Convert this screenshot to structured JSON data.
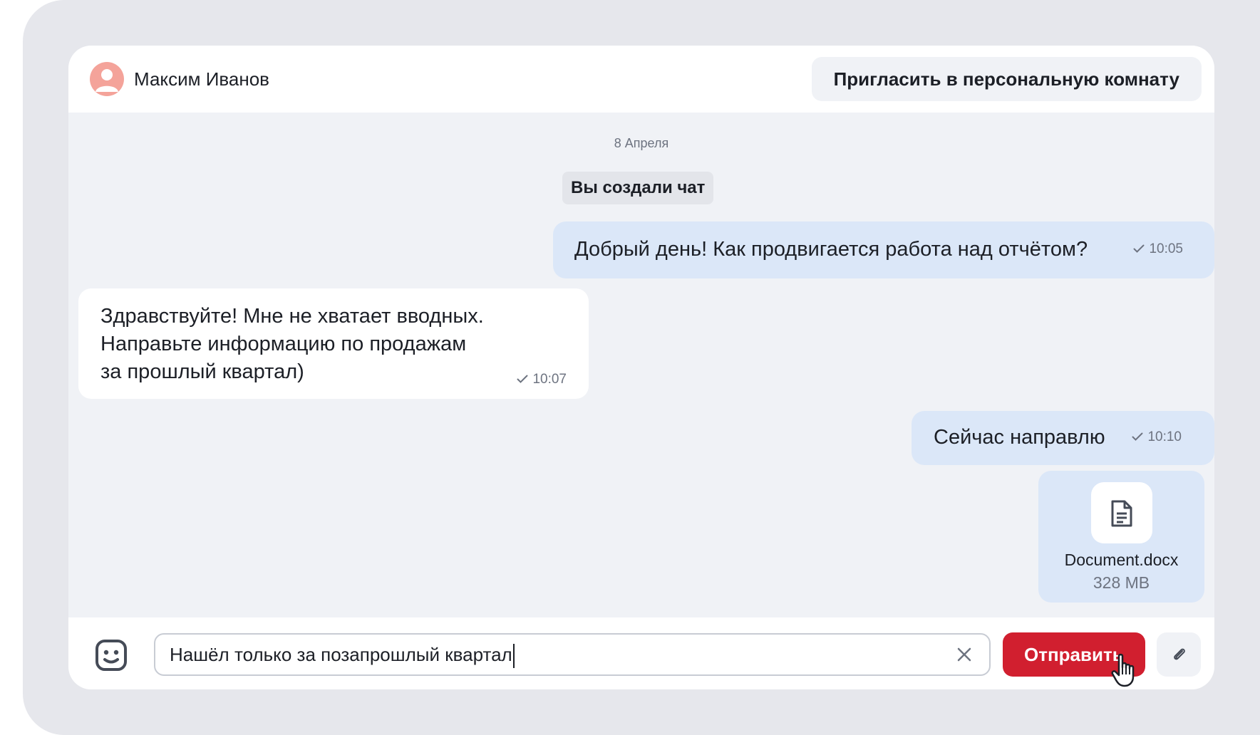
{
  "header": {
    "contact_name": "Максим Иванов",
    "invite_button_label": "Пригласить в персональную комнату"
  },
  "chat": {
    "date_divider": "8 Апреля",
    "system_message": "Вы создали чат",
    "messages": [
      {
        "direction": "outgoing",
        "text": "Добрый день! Как продвигается работа над отчётом?",
        "time": "10:05",
        "status": "sent"
      },
      {
        "direction": "incoming",
        "text": "Здравствуйте! Мне не хватает вводных.\nНаправьте информацию по продажам\nза прошлый квартал)",
        "time": "10:07",
        "status": "sent"
      },
      {
        "direction": "outgoing",
        "text": "Сейчас направлю",
        "time": "10:10",
        "status": "sent"
      }
    ],
    "attachment": {
      "icon": "document-icon",
      "file_name": "Document.docx",
      "file_size": "328 MB"
    }
  },
  "composer": {
    "input_value": "Нашёл только за позапрошлый квартал",
    "send_label": "Отправить",
    "icons": {
      "emoji": "smiley-icon",
      "clear": "close-icon",
      "attach": "paperclip-icon",
      "pointer": "hand-cursor-icon"
    }
  },
  "colors": {
    "accent": "#d11f2f",
    "outgoing_bubble": "#dbe7f8",
    "incoming_bubble": "#ffffff",
    "avatar": "#f4a39a",
    "background": "#f0f2f6"
  }
}
